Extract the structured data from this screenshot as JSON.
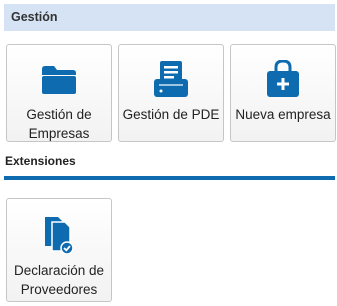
{
  "sections": [
    {
      "title": "Gestión",
      "tiles": [
        {
          "label": "Gestión de Empresas",
          "icon": "folder-icon"
        },
        {
          "label": "Gestión de PDE",
          "icon": "fax-printer-icon"
        },
        {
          "label": "Nueva empresa",
          "icon": "bag-plus-icon"
        }
      ]
    },
    {
      "title": "Extensiones",
      "tiles": [
        {
          "label": "Declaración de Proveedores",
          "icon": "documents-check-icon"
        }
      ]
    }
  ],
  "colors": {
    "accent": "#0e6bb0",
    "header_bg": "#d6e3f4",
    "tile_border": "#c6c6c6"
  }
}
